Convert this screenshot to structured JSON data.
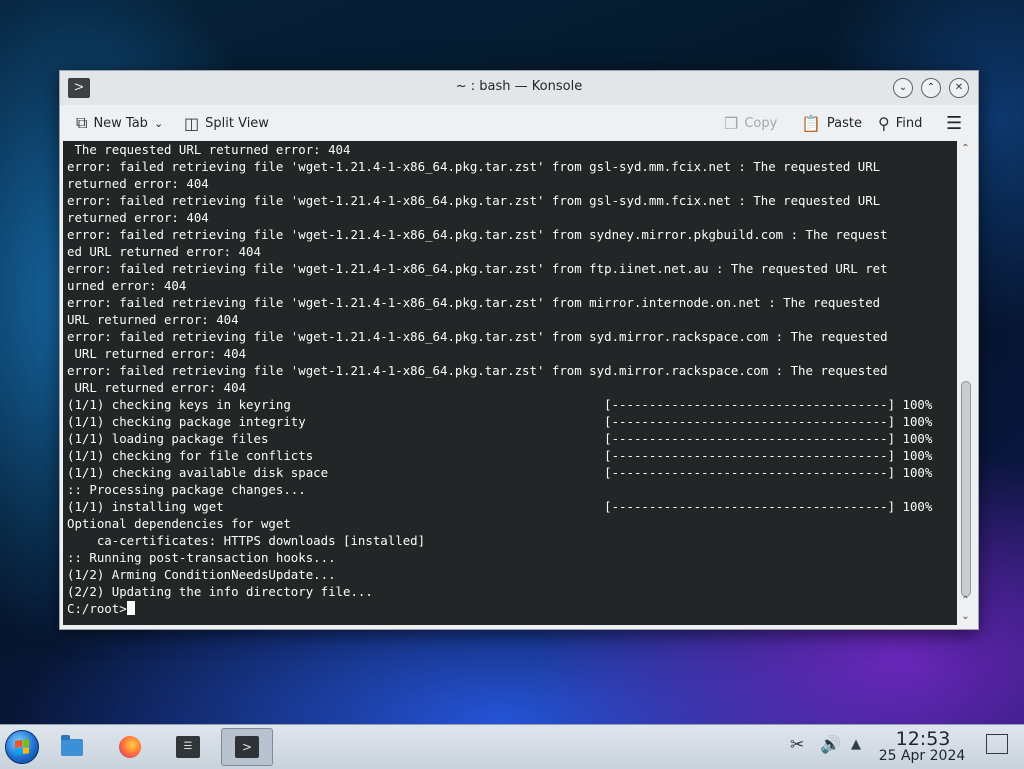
{
  "window": {
    "title": "~ : bash — Konsole",
    "app_icon": "konsole-icon",
    "controls": [
      "minimize",
      "maximize",
      "close"
    ]
  },
  "toolbar": {
    "new_tab": "New Tab",
    "split_view": "Split View",
    "copy": "Copy",
    "paste": "Paste",
    "find": "Find"
  },
  "terminal": {
    "lines": [
      " The requested URL returned error: 404",
      "error: failed retrieving file 'wget-1.21.4-1-x86_64.pkg.tar.zst' from gsl-syd.mm.fcix.net : The requested URL",
      "returned error: 404",
      "error: failed retrieving file 'wget-1.21.4-1-x86_64.pkg.tar.zst' from gsl-syd.mm.fcix.net : The requested URL",
      "returned error: 404",
      "error: failed retrieving file 'wget-1.21.4-1-x86_64.pkg.tar.zst' from sydney.mirror.pkgbuild.com : The request",
      "ed URL returned error: 404",
      "error: failed retrieving file 'wget-1.21.4-1-x86_64.pkg.tar.zst' from ftp.iinet.net.au : The requested URL ret",
      "urned error: 404",
      "error: failed retrieving file 'wget-1.21.4-1-x86_64.pkg.tar.zst' from mirror.internode.on.net : The requested",
      "URL returned error: 404",
      "error: failed retrieving file 'wget-1.21.4-1-x86_64.pkg.tar.zst' from syd.mirror.rackspace.com : The requested",
      " URL returned error: 404",
      "error: failed retrieving file 'wget-1.21.4-1-x86_64.pkg.tar.zst' from syd.mirror.rackspace.com : The requested",
      " URL returned error: 404",
      "(1/1) checking keys in keyring                                          [-------------------------------------] 100%",
      "(1/1) checking package integrity                                        [-------------------------------------] 100%",
      "(1/1) loading package files                                             [-------------------------------------] 100%",
      "(1/1) checking for file conflicts                                       [-------------------------------------] 100%",
      "(1/1) checking available disk space                                     [-------------------------------------] 100%",
      ":: Processing package changes...",
      "(1/1) installing wget                                                   [-------------------------------------] 100%",
      "Optional dependencies for wget",
      "    ca-certificates: HTTPS downloads [installed]",
      ":: Running post-transaction hooks...",
      "(1/2) Arming ConditionNeedsUpdate...",
      "(2/2) Updating the info directory file..."
    ],
    "prompt": "C:/root>"
  },
  "taskbar": {
    "pinned": [
      "start-menu",
      "file-manager",
      "firefox",
      "system-settings",
      "konsole"
    ],
    "active": "konsole",
    "tray_icons": [
      "clipboard-icon",
      "volume-icon",
      "tray-expand-icon"
    ],
    "clock_time": "12:53",
    "clock_date": "25 Apr 2024"
  }
}
